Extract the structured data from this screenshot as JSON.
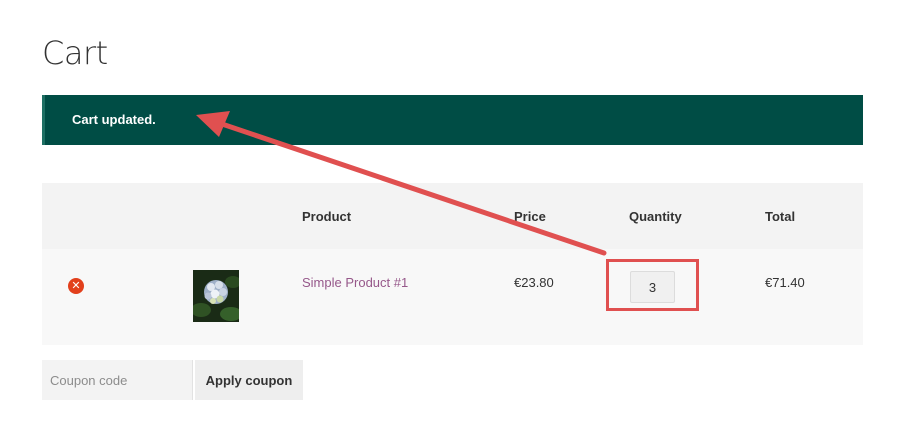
{
  "page": {
    "title": "Cart"
  },
  "notice": {
    "message": "Cart updated."
  },
  "table": {
    "headers": {
      "product": "Product",
      "price": "Price",
      "quantity": "Quantity",
      "total": "Total"
    },
    "rows": [
      {
        "remove_symbol": "✕",
        "product_name": "Simple Product #1",
        "price": "€23.80",
        "quantity": "3",
        "total": "€71.40"
      }
    ]
  },
  "coupon": {
    "placeholder": "Coupon code",
    "apply_label": "Apply coupon"
  },
  "annotation": {
    "color": "#e05050"
  },
  "colors": {
    "notice_bg": "#004d45",
    "product_link": "#96588a",
    "remove_button": "#e2401c"
  }
}
